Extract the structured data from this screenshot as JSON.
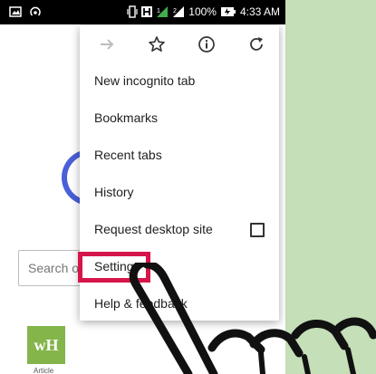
{
  "status_bar": {
    "battery": "100%",
    "time": "4:33 AM"
  },
  "page": {
    "search_placeholder": "Search o",
    "tile_label": "wH",
    "tile_caption": "Article"
  },
  "menu": {
    "toolbar": {
      "forward_icon": "arrow-right",
      "bookmark_icon": "star",
      "info_icon": "info",
      "reload_icon": "reload"
    },
    "items": [
      {
        "label": "New incognito tab"
      },
      {
        "label": "Bookmarks"
      },
      {
        "label": "Recent tabs"
      },
      {
        "label": "History"
      },
      {
        "label": "Request desktop site",
        "checkbox_checked": false
      },
      {
        "label": "Settings",
        "highlighted": true
      },
      {
        "label": "Help & feedback"
      }
    ]
  },
  "colors": {
    "highlight": "#d6154a",
    "background": "#c5dfb8",
    "tile": "#83b54b",
    "google_g": "#4a5fd8"
  }
}
